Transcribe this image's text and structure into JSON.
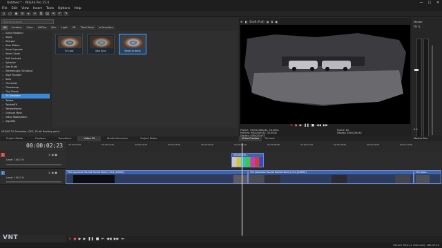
{
  "window": {
    "title": "Untitled * - VEGAS Pro 15.0",
    "controls": [
      "—",
      "□",
      "✕"
    ]
  },
  "menu": [
    "File",
    "Edit",
    "View",
    "Insert",
    "Tools",
    "Options",
    "Help"
  ],
  "toolbar_icons": [
    "new-icon",
    "open-icon",
    "save-icon",
    "properties-icon",
    "render-icon",
    "cut-icon",
    "copy-icon",
    "paste-icon",
    "delete-icon",
    "undo-icon",
    "redo-icon"
  ],
  "effects": {
    "search_placeholder": "Search plug-ins",
    "tabs": [
      "All",
      "Creative",
      "Color",
      "HitFilm",
      "Blur",
      "Light",
      "VR",
      "Third Party",
      "★ Favorites"
    ],
    "list": [
      "Scene Rotation",
      "Sepia",
      "Sharpen",
      "Slow Motion",
      "Smart Upscale",
      "Smart Zoom",
      "Soft Contrast",
      "Spherize",
      "Star Burst",
      "Stereoscopic 3D Adjust",
      "Style Transfer",
      "Swirl",
      "Threshold",
      "Timestamp",
      "Tiny Planet",
      "TV Simulator",
      "Twister",
      "TwistedFX",
      "TwistedVector",
      "Unsharp Mask",
      "Video Stabilization",
      "Vignette"
    ],
    "selected_index": 15,
    "presets": [
      {
        "label": "TV Look",
        "selected": false
      },
      {
        "label": "Bad Sync",
        "selected": false
      },
      {
        "label": "Reset to None",
        "selected": true
      }
    ],
    "info": "VEGAS TV Simulator: OXF, 32-bit floating point"
  },
  "panel_tabs": [
    "Project Media",
    "Explorer",
    "Transitions",
    "Video FX",
    "Media Generator",
    "Project Notes"
  ],
  "preview": {
    "toolbar": [
      "Draft (Full)"
    ],
    "controls": [
      "⟲",
      "●",
      "▶",
      "❚❚",
      "■",
      "◀◀",
      "▶▶"
    ],
    "info_left": [
      "Project: 1920x1080x32, 30.000p",
      "Preview: 960x540x32, 30.000p",
      "Display: 400x225x32"
    ],
    "info_right": [
      "Frame: 62",
      "Display: 400x226x32"
    ],
    "tabs": [
      "Video Preview",
      "Trimmer"
    ]
  },
  "master": {
    "title": "Master",
    "tab": "Master Bus",
    "readout": "0.0"
  },
  "timeline": {
    "timecode": "00:00:02;23",
    "ticks": [
      "00:00:00;00",
      "00:00:01;00",
      "00:00:02;00",
      "00:00:03;00",
      "00:00:04;00",
      "00:00:05;00",
      "00:00:06;00",
      "00:00:07;00",
      "00:00:08;00",
      "00:00:09;00",
      "00:00:10;00"
    ],
    "tracks": [
      {
        "number": "1",
        "label": "Level: 100.0 %",
        "clips": [
          {
            "title": "VEGAS Titl..."
          }
        ]
      },
      {
        "number": "2",
        "label": "Level: 100.0 %",
        "clips": [
          {
            "title": "The Japanese Tourist Rocket Bunny C14 [24002]"
          },
          {
            "title": "The Japanese Tourist Rocket Bunny C14 [24002]"
          },
          {
            "title": "The Japa..."
          }
        ]
      }
    ]
  },
  "transport": [
    "⟲",
    "●",
    "▶",
    "▶",
    "❚❚",
    "■",
    "⏮",
    "◀◀",
    "▶▶",
    "⏭"
  ],
  "status": {
    "right": "Record Time (2 channels): 182:47:20"
  },
  "watermark": "VNT"
}
